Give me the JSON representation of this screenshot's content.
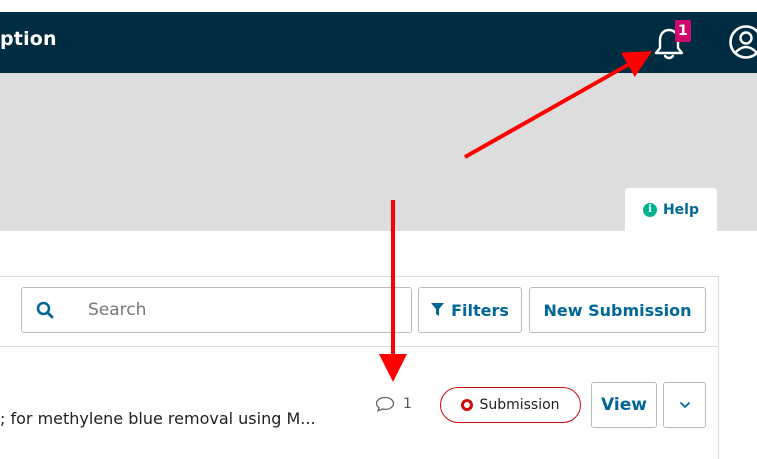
{
  "topbar": {
    "title": "ption",
    "notification_count": "1"
  },
  "help": {
    "label": "Help"
  },
  "toolbar": {
    "search_placeholder": "Search",
    "filters_label": "Filters",
    "new_submission_label": "New Submission"
  },
  "submission": {
    "title": "; for methylene blue removal using M...",
    "comment_count": "1",
    "stage": "Submission",
    "view_label": "View"
  },
  "colors": {
    "topbar": "#002c41",
    "badge": "#d00a6c",
    "link": "#006798",
    "help_icon": "#00b28d",
    "stage_red": "#d00a0a",
    "annotation_arrow": "#ff0000"
  },
  "icons": [
    "bell-icon",
    "user-circle-icon",
    "info-icon",
    "search-icon",
    "filter-icon",
    "comment-icon",
    "chevron-down-icon"
  ]
}
